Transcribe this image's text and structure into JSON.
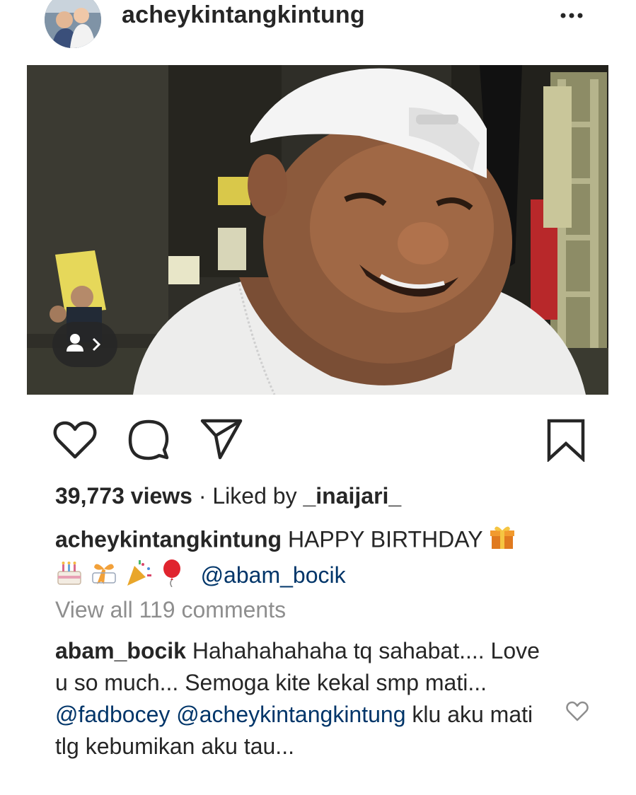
{
  "header": {
    "username": "acheykintangkintung",
    "more_icon": "more-dots-icon"
  },
  "post": {
    "tag_icon": "user-tag-icon",
    "actions": {
      "like_icon": "heart-icon",
      "comment_icon": "comment-bubble-icon",
      "share_icon": "paper-plane-icon",
      "save_icon": "bookmark-icon"
    },
    "views": "39,773 views",
    "liked_by_prefix": "· Liked by",
    "liked_by_user": "_inaijari_",
    "caption": {
      "author": "acheykintangkintung",
      "text": "HAPPY BIRTHDAY",
      "emojis": [
        "gift",
        "birthday-cake",
        "ribbon",
        "party-popper",
        "balloon"
      ],
      "mention": "@abam_bocik"
    },
    "view_all_comments": "View all 119 comments",
    "comments": [
      {
        "author": "abam_bocik",
        "text_part1": "Hahahahahaha tq sahabat.... Love u so much... Semoga kite kekal smp mati...",
        "mention1": "@fadbocey",
        "mention2": "@acheykintangkintung",
        "text_part2": "klu aku mati tlg kebumikan aku tau..."
      }
    ]
  },
  "colors": {
    "text": "#262626",
    "muted": "#8e8e8e",
    "mention": "#003569"
  }
}
